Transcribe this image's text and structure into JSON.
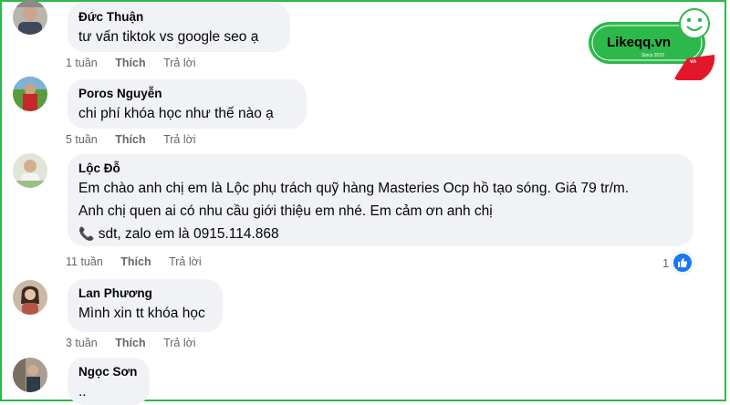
{
  "brand": {
    "name": "Likeqq.vn",
    "tagline": "Since 2015",
    "badge": "vn",
    "colors": {
      "green": "#2db84b",
      "red": "#e3172a"
    }
  },
  "ui_colors": {
    "bubble": "#f0f2f5",
    "meta": "#65676b",
    "like": "#1877f2"
  },
  "comments": [
    {
      "author": "Đức Thuận",
      "lines": [
        "tư vấn tiktok vs google seo ạ"
      ],
      "time": "1 tuần",
      "like_label": "Thích",
      "reply_label": "Trả lời"
    },
    {
      "author": "Poros Nguyễn",
      "lines": [
        "chi phí khóa học như thế nào ạ"
      ],
      "time": "5 tuần",
      "like_label": "Thích",
      "reply_label": "Trả lời"
    },
    {
      "author": "Lộc Đỗ",
      "lines": [
        "Em chào anh chị em là Lộc phụ trách quỹ hàng Masteries Ocp hồ tạo sóng. Giá 79 tr/m.",
        "Anh chị quen ai có nhu cầu giới thiệu em nhé. Em cảm ơn anh chị",
        "sdt, zalo em là 0915.114.868"
      ],
      "phone_icon": "phone-icon",
      "time": "11 tuần",
      "like_label": "Thích",
      "reply_label": "Trả lời",
      "reaction_count": "1"
    },
    {
      "author": "Lan Phương",
      "lines": [
        "Mình xin tt khóa học"
      ],
      "time": "3 tuần",
      "like_label": "Thích",
      "reply_label": "Trả lời"
    },
    {
      "author": "Ngọc Sơn",
      "lines": [
        ".."
      ]
    }
  ]
}
